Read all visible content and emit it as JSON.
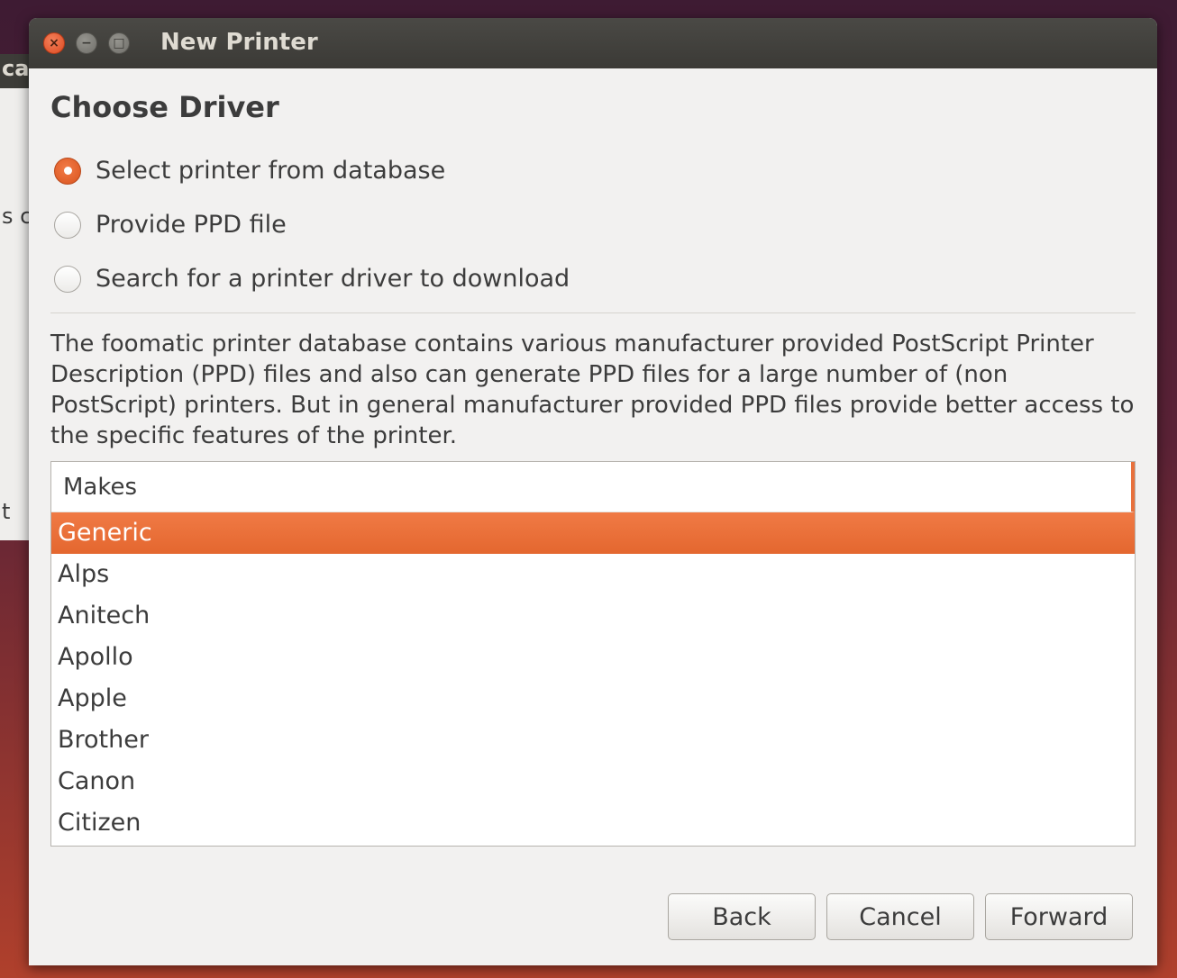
{
  "background_window": {
    "fragments": [
      "ca",
      "s c",
      "t"
    ]
  },
  "window": {
    "title": "New Printer",
    "controls": {
      "close": "×",
      "minimize": "−",
      "maximize": "□"
    }
  },
  "page": {
    "heading": "Choose Driver"
  },
  "options": [
    {
      "label": "Select printer from database",
      "selected": true
    },
    {
      "label": "Provide PPD file",
      "selected": false
    },
    {
      "label": "Search for a printer driver to download",
      "selected": false
    }
  ],
  "description": "The foomatic printer database contains various manufacturer provided PostScript Printer Description (PPD) files and also can generate PPD files for a large number of (non PostScript) printers. But in general manufacturer provided PPD files provide better access to the specific features of the printer.",
  "makes_list": {
    "header": "Makes",
    "items": [
      "Generic",
      "Alps",
      "Anitech",
      "Apollo",
      "Apple",
      "Brother",
      "Canon",
      "Citizen"
    ],
    "selected": "Generic"
  },
  "buttons": {
    "back": "Back",
    "cancel": "Cancel",
    "forward": "Forward"
  },
  "colors": {
    "accent": "#e8713d",
    "titlebar": "#3d3c38",
    "dialog_bg": "#f2f1f0"
  }
}
